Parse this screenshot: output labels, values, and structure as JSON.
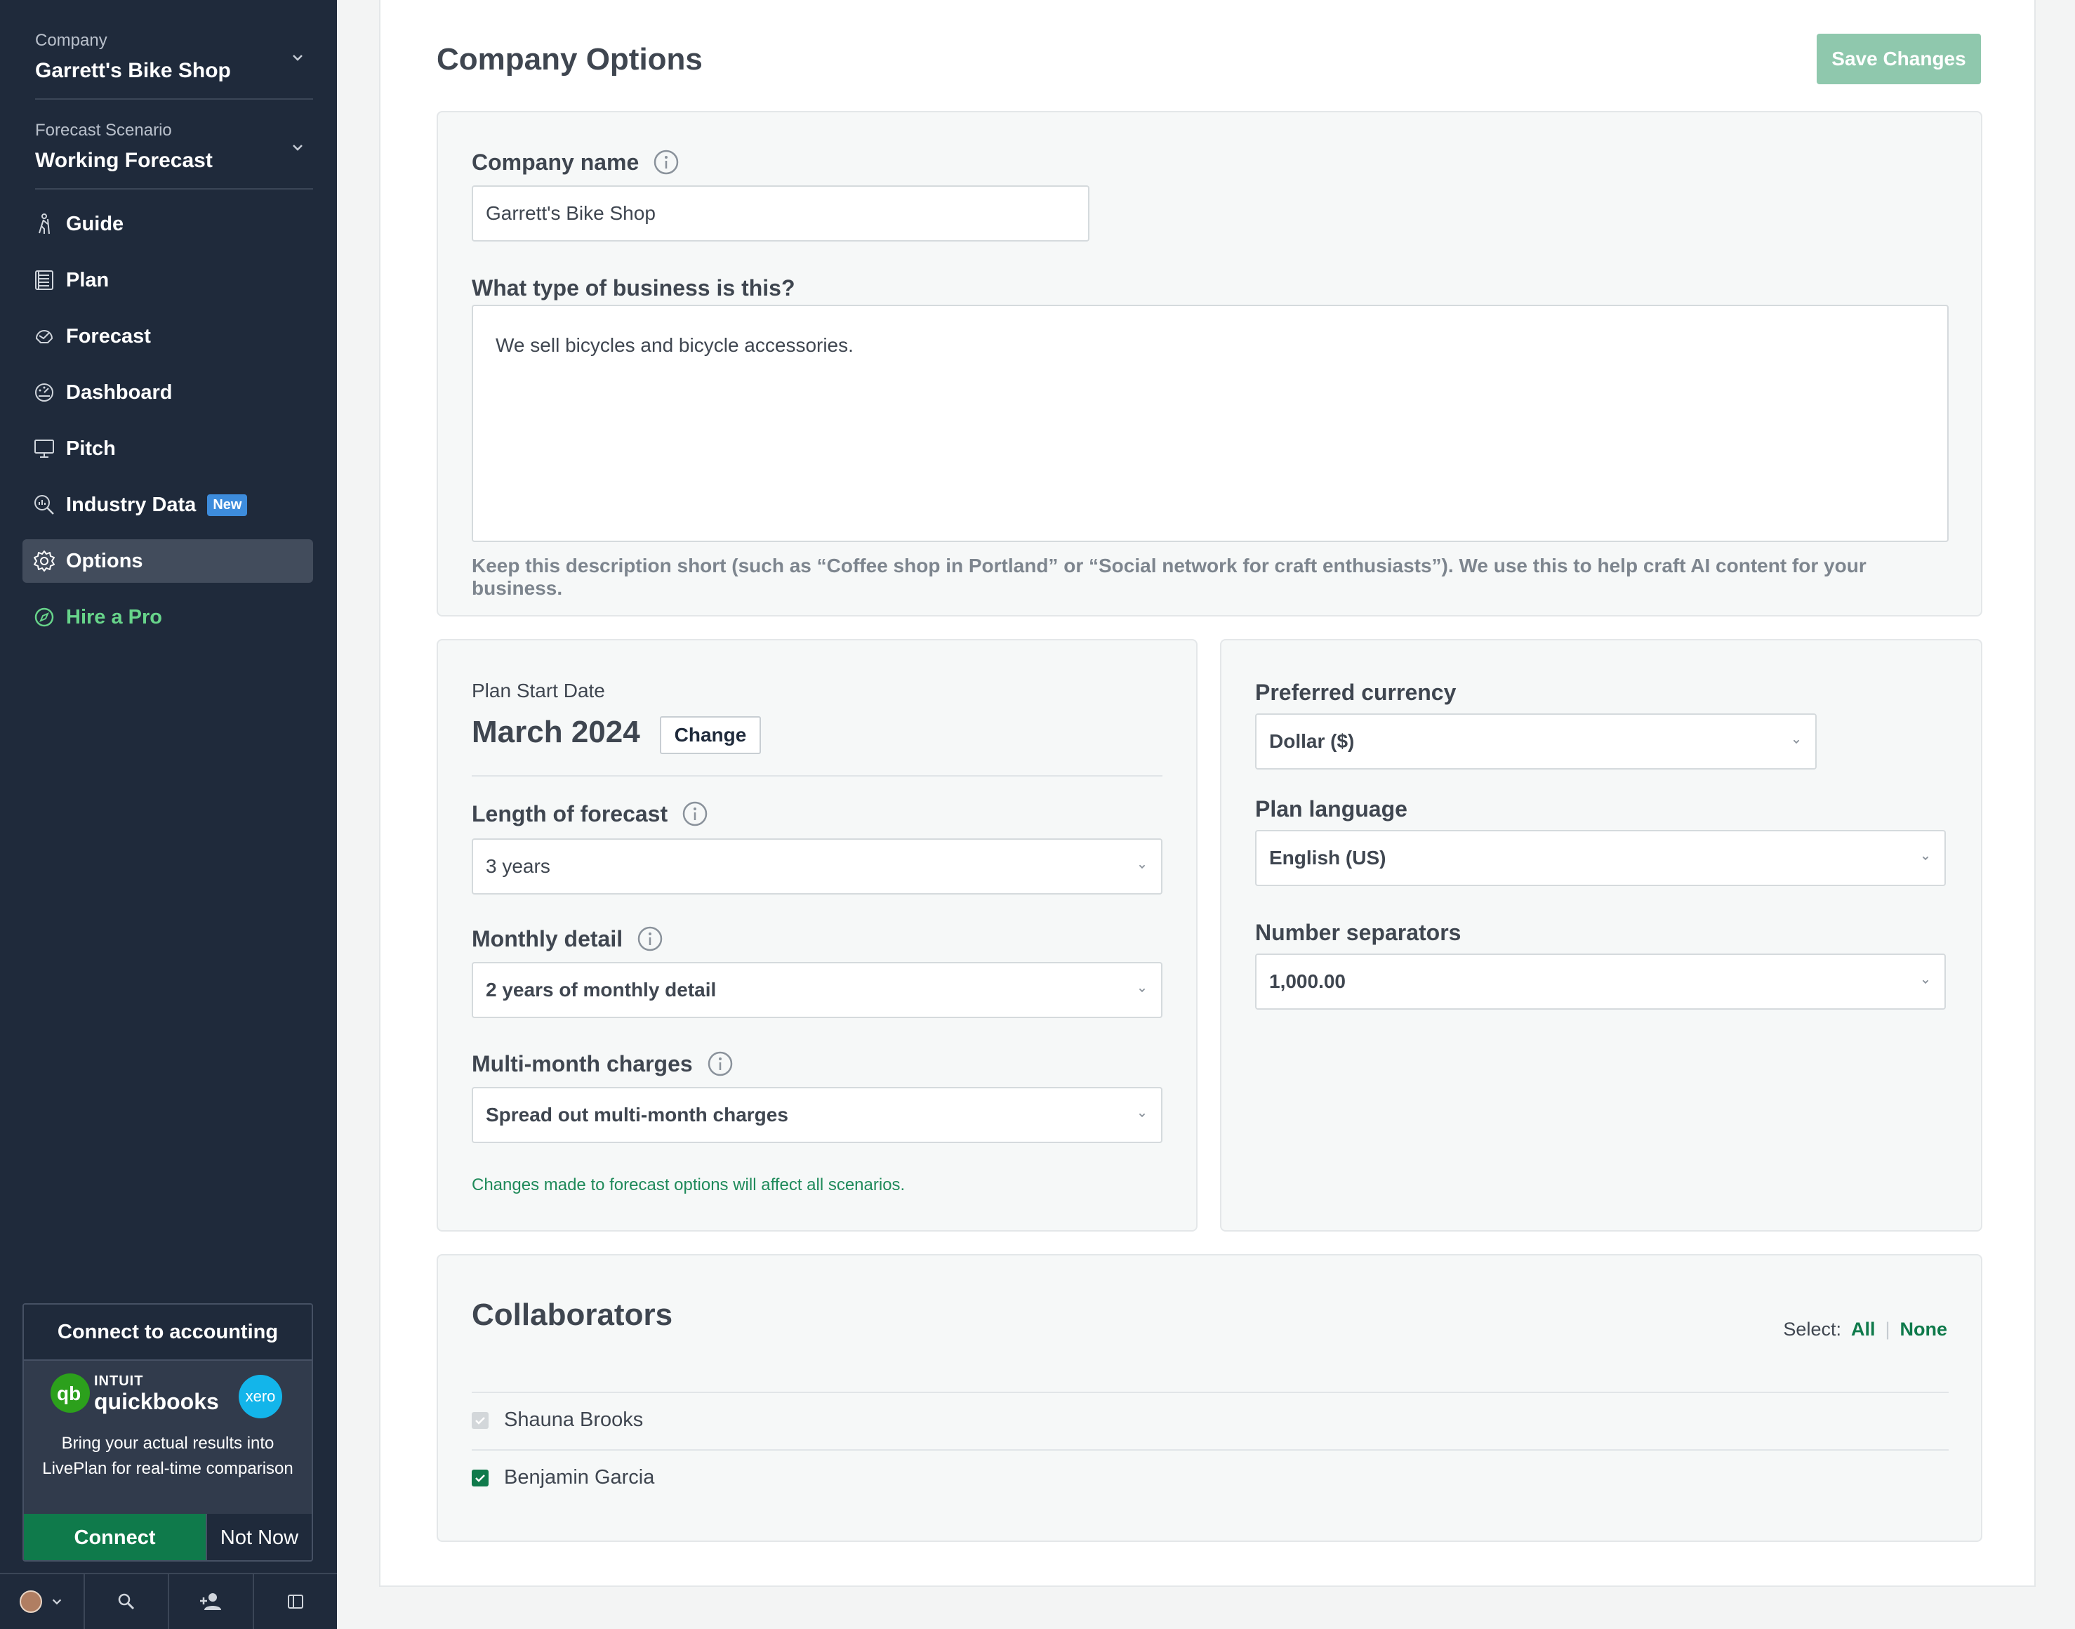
{
  "sidebar": {
    "company": {
      "label": "Company",
      "value": "Garrett's Bike Shop"
    },
    "scenario": {
      "label": "Forecast Scenario",
      "value": "Working Forecast"
    },
    "nav": [
      {
        "label": "Guide",
        "icon": "hiker-icon"
      },
      {
        "label": "Plan",
        "icon": "plan-document-icon"
      },
      {
        "label": "Forecast",
        "icon": "forecast-icon"
      },
      {
        "label": "Dashboard",
        "icon": "dashboard-gauge-icon"
      },
      {
        "label": "Pitch",
        "icon": "monitor-icon"
      },
      {
        "label": "Industry Data",
        "icon": "magnify-chart-icon",
        "badge": "New"
      },
      {
        "label": "Options",
        "icon": "gear-icon",
        "active": true
      },
      {
        "label": "Hire a Pro",
        "icon": "compass-icon"
      }
    ],
    "accounting": {
      "title": "Connect to accounting",
      "intuit": "INTUIT",
      "quickbooks": "quickbooks",
      "xero": "xero",
      "description": "Bring your actual results into LivePlan for real-time comparison",
      "connect_label": "Connect",
      "not_now_label": "Not Now"
    }
  },
  "main": {
    "title": "Company Options",
    "save_label": "Save Changes",
    "company_name_label": "Company name",
    "company_name_value": "Garrett's Bike Shop",
    "business_type_label": "What type of business is this?",
    "business_type_value": "We sell bicycles and bicycle accessories.",
    "business_type_hint": "Keep this description short (such as “Coffee shop in Portland” or “Social network for craft enthusiasts”). We use this to help craft AI content for your business.",
    "plan_start_label": "Plan Start Date",
    "plan_start_value": "March 2024",
    "change_label": "Change",
    "length_label": "Length of forecast",
    "length_value": "3 years",
    "monthly_label": "Monthly detail",
    "monthly_value": "2 years of monthly detail",
    "multimonth_label": "Multi-month charges",
    "multimonth_value": "Spread out multi-month charges",
    "forecast_note": "Changes made to forecast options will affect all scenarios.",
    "currency_label": "Preferred currency",
    "currency_value": "Dollar ($)",
    "language_label": "Plan language",
    "language_value": "English (US)",
    "separators_label": "Number separators",
    "separators_value": "1,000.00",
    "collaborators_title": "Collaborators",
    "select_label": "Select:",
    "select_all": "All",
    "select_none": "None",
    "collaborators": [
      {
        "name": "Shauna Brooks",
        "checked": true,
        "disabled": true
      },
      {
        "name": "Benjamin Garcia",
        "checked": true,
        "disabled": false
      }
    ]
  },
  "colors": {
    "sidebar_bg": "#1f2a3b",
    "accent_green": "#0f7a4b",
    "save_disabled": "#8fc8ad",
    "pro_green": "#67d48a",
    "badge_blue": "#3d8cdc"
  }
}
